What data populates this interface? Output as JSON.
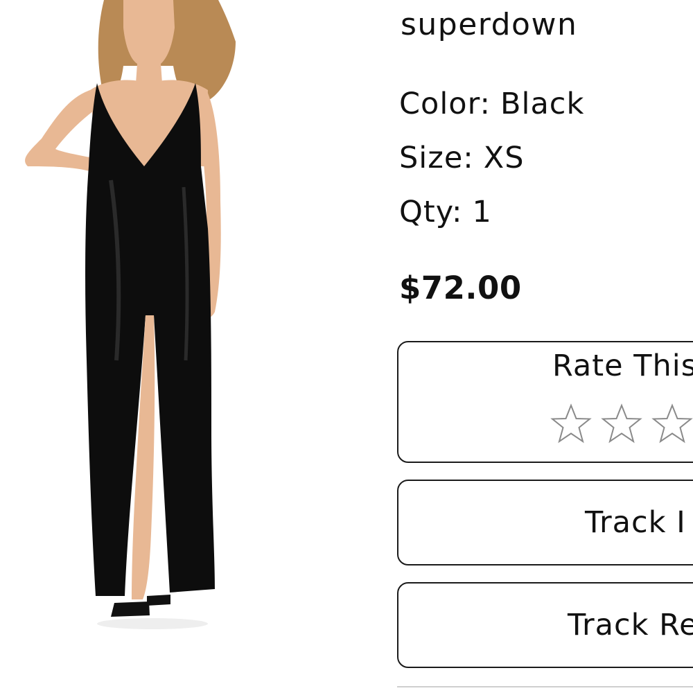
{
  "product": {
    "image_alt": "Black velvet plunging maxi dress with front slit",
    "brand": "superdown",
    "color_label": "Color:",
    "color_value": "Black",
    "size_label": "Size:",
    "size_value": "XS",
    "qty_label": "Qty:",
    "qty_value": "1",
    "price": "$72.00"
  },
  "rating": {
    "label": "Rate This",
    "stars_visible": 3,
    "current_rating": 0,
    "star_outline_color": "#8a8a8a"
  },
  "actions": {
    "track_item_label": "Track I",
    "track_return_label": "Track Re"
  },
  "colors": {
    "text": "#111111",
    "border": "#1a1a1a",
    "dress": "#0d0d0d",
    "skin": "#e8b894",
    "hair": "#b98a55"
  }
}
